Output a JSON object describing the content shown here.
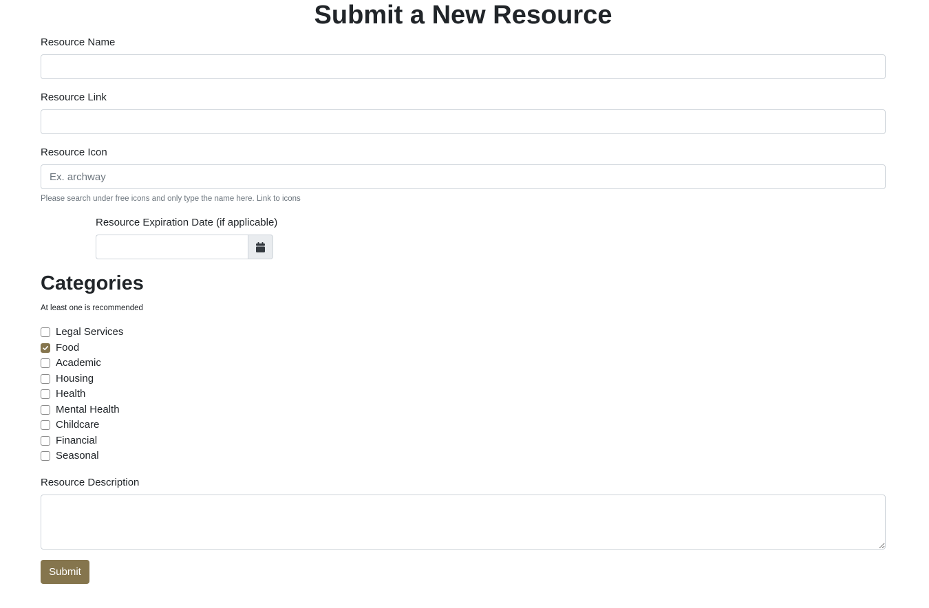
{
  "page": {
    "title": "Submit a New Resource"
  },
  "form": {
    "resource_name": {
      "label": "Resource Name",
      "value": "",
      "placeholder": ""
    },
    "resource_link": {
      "label": "Resource Link",
      "value": "",
      "placeholder": ""
    },
    "resource_icon": {
      "label": "Resource Icon",
      "value": "",
      "placeholder": "Ex. archway",
      "help_text": "Please search under free icons and only type the name here. Link to icons"
    },
    "expiration_date": {
      "label": "Resource Expiration Date (if applicable)",
      "value": "",
      "button_icon": "calendar-icon"
    },
    "categories": {
      "heading": "Categories",
      "subtext": "At least one is recommended",
      "items": [
        {
          "label": "Legal Services",
          "checked": false
        },
        {
          "label": "Food",
          "checked": true
        },
        {
          "label": "Academic",
          "checked": false
        },
        {
          "label": "Housing",
          "checked": false
        },
        {
          "label": "Health",
          "checked": false
        },
        {
          "label": "Mental Health",
          "checked": false
        },
        {
          "label": "Childcare",
          "checked": false
        },
        {
          "label": "Financial",
          "checked": false
        },
        {
          "label": "Seasonal",
          "checked": false
        }
      ]
    },
    "resource_description": {
      "label": "Resource Description",
      "value": ""
    },
    "submit_label": "Submit"
  },
  "colors": {
    "accent": "#85754d",
    "text": "#212529",
    "muted": "#6c757d",
    "input_border": "#ced4da",
    "addon_background": "#e9ecef"
  }
}
